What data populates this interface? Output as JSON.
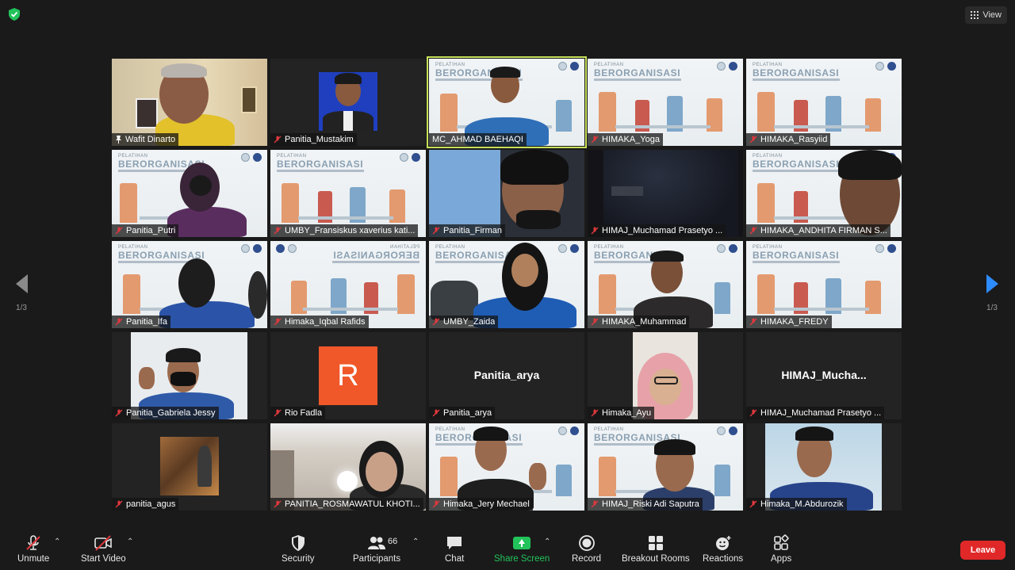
{
  "top": {
    "view_label": "View"
  },
  "paging": {
    "left": "1/3",
    "right": "1/3"
  },
  "participants": [
    "Wafit Dinarto",
    "Panitia_Mustakim",
    "MC_AHMAD BAEHAQI",
    "HIMAKA_Yoga",
    "HIMAKA_Rasyiid",
    "Panitia_Putri",
    "UMBY_Fransiskus xaverius kati...",
    "Panitia_Firman",
    "HIMAJ_Muchamad Prasetyo ...",
    "HIMAKA_ANDHITA FIRMAN S...",
    "Panitia_Ifa",
    "Himaka_Iqbal Rafids",
    "UMBY_Zaida",
    "HIMAKA_Muhammad",
    "HIMAKA_FREDY",
    "Panitia_Gabriela Jessy",
    "Rio Fadla",
    "Panitia_arya",
    "Himaka_Ayu",
    "HIMAJ_Muchamad Prasetyo ...",
    "panitia_agus",
    "PANITIA_ROSMAWATUL KHOTI...",
    "Himaka_Jery Mechael",
    "HIMAJ_Riski Adi Saputra",
    "Himaka_M.Abdurozik"
  ],
  "tile_text": {
    "banner_pre": "PELATIHAN",
    "banner_title": "BERORGANISASI",
    "rio_initial": "R",
    "arya_big": "Panitia_arya",
    "himaj_big": "HIMAJ_Mucha..."
  },
  "toolbar": {
    "unmute": "Unmute",
    "start_video": "Start Video",
    "security": "Security",
    "participants": "Participants",
    "participants_count": "66",
    "chat": "Chat",
    "share_screen": "Share Screen",
    "record": "Record",
    "breakout_rooms": "Breakout Rooms",
    "reactions": "Reactions",
    "apps": "Apps",
    "leave": "Leave"
  },
  "colors": {
    "accent_blue": "#2d8cff",
    "share_green": "#22c35a",
    "leave_red": "#e02828",
    "active_speaker": "#c6e15a"
  }
}
